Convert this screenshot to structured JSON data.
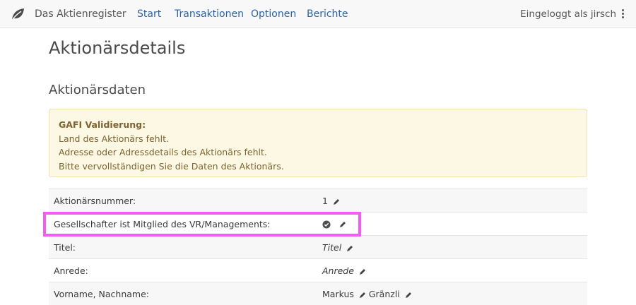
{
  "navbar": {
    "brand": "Das Aktienregister",
    "links": [
      "Start",
      "Transaktionen",
      "Optionen",
      "Berichte"
    ],
    "user_text": "Eingeloggt als jirsch"
  },
  "page": {
    "title": "Aktionärsdetails",
    "section_title": "Aktionärsdaten"
  },
  "alert": {
    "title": "GAFI Validierung:",
    "lines": [
      "Land des Aktionärs fehlt.",
      "Adresse oder Adressdetails des Aktionärs fehlt.",
      "Bitte vervollständigen Sie die Daten des Aktionärs."
    ]
  },
  "details": [
    {
      "label": "Aktionärsnummer:",
      "value": "1"
    },
    {
      "label": "Gesellschafter ist Mitglied des VR/Managements:",
      "value_icon": "check-circle-icon"
    },
    {
      "label": "Titel:",
      "value": "Titel",
      "placeholder": true
    },
    {
      "label": "Anrede:",
      "value": "Anrede",
      "placeholder": true
    },
    {
      "label": "Vorname, Nachname:",
      "first_name": "Markus",
      "last_name": "Gränzli"
    }
  ],
  "colors": {
    "link": "#2a62a8",
    "alert_bg": "#fcf8e3",
    "alert_text": "#7d6431",
    "highlight": "#f25cf0"
  }
}
